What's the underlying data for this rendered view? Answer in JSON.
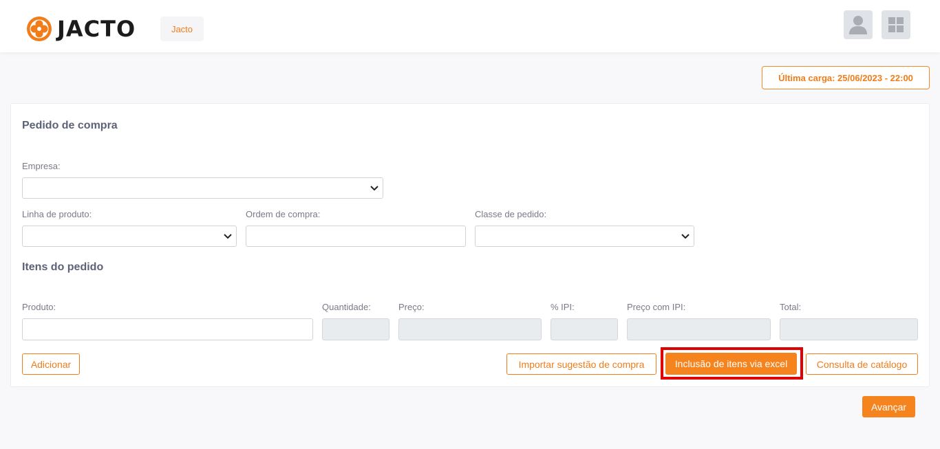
{
  "header": {
    "brand_name": "JACTO",
    "chip_label": "Jacto",
    "user_icon": "user-icon",
    "apps_icon": "grid-icon"
  },
  "status": {
    "last_load": "Última carga: 25/06/2023 - 22:00"
  },
  "order": {
    "title": "Pedido de compra",
    "empresa_label": "Empresa:",
    "linha_label": "Linha de produto:",
    "ordem_label": "Ordem de compra:",
    "classe_label": "Classe de pedido:"
  },
  "items": {
    "title": "Itens do pedido",
    "produto_label": "Produto:",
    "quantidade_label": "Quantidade:",
    "preco_label": "Preço:",
    "ipi_label": "% IPI:",
    "preco_ipi_label": "Preço com IPI:",
    "total_label": "Total:"
  },
  "actions": {
    "adicionar": "Adicionar",
    "importar": "Importar sugestão de compra",
    "inclusao_excel": "Inclusão de itens via excel",
    "consulta": "Consulta de catálogo",
    "avancar": "Avançar"
  },
  "colors": {
    "accent": "#f5841f",
    "highlight": "#e00000"
  }
}
